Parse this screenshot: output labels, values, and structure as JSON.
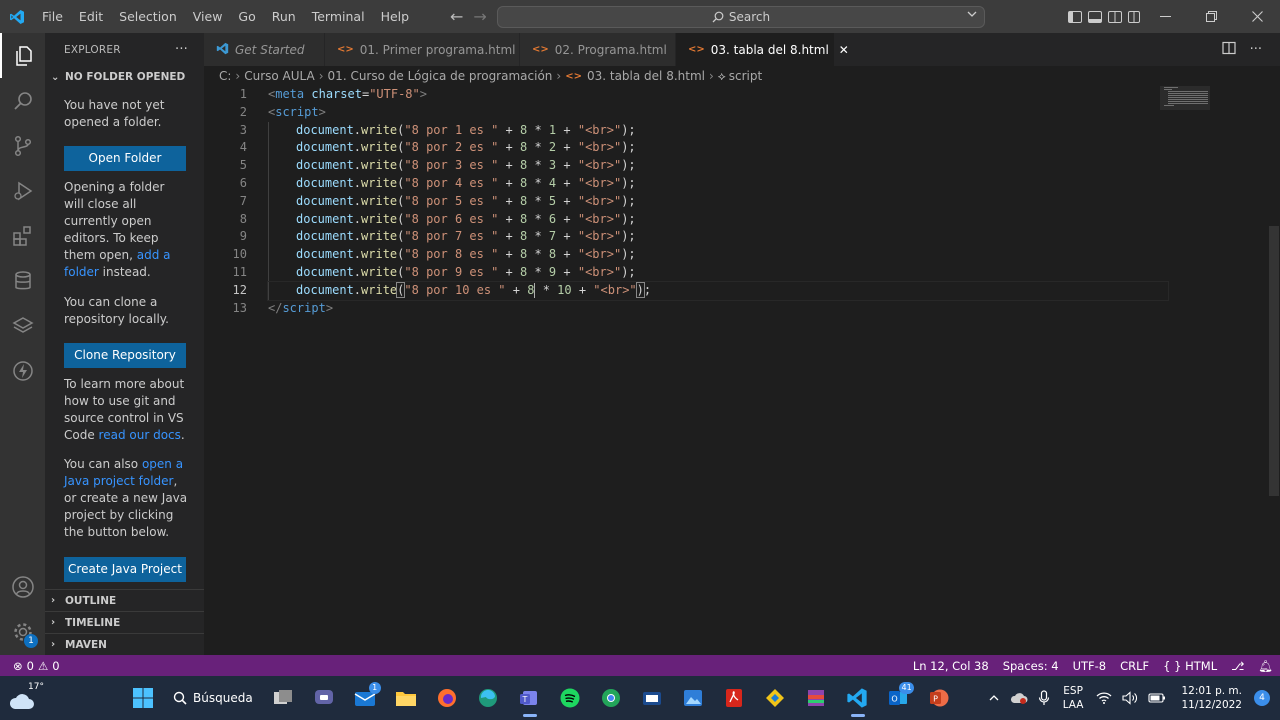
{
  "titlebar": {
    "menu": [
      "File",
      "Edit",
      "Selection",
      "View",
      "Go",
      "Run",
      "Terminal",
      "Help"
    ],
    "search_label": "Search"
  },
  "activitybar": {
    "settings_badge": "1"
  },
  "sidebar": {
    "title": "EXPLORER",
    "more": "···",
    "section": "NO FOLDER OPENED",
    "p1": "You have not yet opened a folder.",
    "open_folder": "Open Folder",
    "p2_a": "Opening a folder will close all currently open editors. To keep them open, ",
    "p2_link": "add a folder",
    "p2_b": " instead.",
    "p3": "You can clone a repository locally.",
    "clone": "Clone Repository",
    "p4_a": "To learn more about how to use git and source control in VS Code ",
    "p4_link": "read our docs",
    "p4_b": ".",
    "p5_a": "You can also ",
    "p5_link": "open a Java project folder",
    "p5_b": ", or create a new Java project by clicking the button below.",
    "create_java": "Create Java Project",
    "bottom_sections": [
      "OUTLINE",
      "TIMELINE",
      "MAVEN"
    ]
  },
  "tabs": [
    {
      "label": "Get Started",
      "icon": "vscode-icon",
      "active": false
    },
    {
      "label": "01. Primer programa.html",
      "icon": "html-icon",
      "active": false
    },
    {
      "label": "02. Programa.html",
      "icon": "html-icon",
      "active": false
    },
    {
      "label": "03. tabla del 8.html",
      "icon": "html-icon",
      "active": true
    }
  ],
  "breadcrumb": [
    "C:",
    "Curso AULA",
    "01. Curso de Lógica de programación",
    "03. tabla del 8.html",
    "script"
  ],
  "editor": {
    "line_numbers": [
      "1",
      "2",
      "3",
      "4",
      "5",
      "6",
      "7",
      "8",
      "9",
      "10",
      "11",
      "12",
      "13"
    ],
    "current_line": 12
  },
  "statusbar": {
    "errors": "0",
    "warnings": "0",
    "position": "Ln 12, Col 38",
    "spaces": "Spaces: 4",
    "encoding": "UTF-8",
    "eol": "CRLF",
    "language": "HTML"
  },
  "taskbar": {
    "temperature": "17°",
    "search_label": "Búsqueda",
    "mail_badge": "1",
    "store_badge": "41",
    "lang_top": "ESP",
    "lang_bottom": "LAA",
    "time": "12:01 p. m.",
    "date": "11/12/2022",
    "notifications": "4"
  }
}
